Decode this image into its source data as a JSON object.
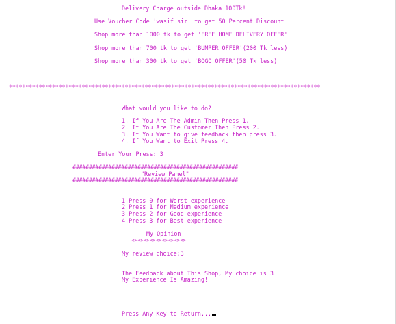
{
  "offers": {
    "line1": "Delivery Charge outside Dhaka 100Tk!",
    "line2": "Use Voucher Code 'wasif sir' to get 50 Percent Discount",
    "line3": "Shop more than 1000 tk to get 'FREE HOME DELIVERY OFFER'",
    "line4": "Shop more than 700 tk to get 'BUMPER OFFER'(200 Tk less)",
    "line5": "Shop more than 300 tk to get 'BOGO OFFER'(50 Tk less)"
  },
  "separator": "**********************************************************************************************",
  "main_menu": {
    "question": "What would you like to do?",
    "options": [
      "1. If You Are The Admin Then Press 1.",
      "2. If You Are The Customer Then Press 2.",
      "3. If You Want to give feedback then press 3.",
      "4. If You Want to Exit Press 4."
    ],
    "prompt": "Enter Your Press: 3"
  },
  "review_panel": {
    "border_top": "###################################################",
    "title": "\"Review Panel\"",
    "border_bottom": "###################################################",
    "options": [
      "1.Press 0 for Worst experience",
      "2.Press 1 for Medium experience",
      "3.Press 2 for Good experience",
      "4.Press 3 for Best experience"
    ],
    "opinion_heading": "My Opinion",
    "opinion_divider": "<><><><><><><><><>",
    "choice_line": "My review choice:3",
    "feedback_line1": "The Feedback about This Shop, My choice is 3",
    "feedback_line2": "My Experience Is Amazing!"
  },
  "footer": {
    "return_prompt": "Press Any Key to Return..."
  },
  "colors": {
    "text": "#c61fc6",
    "background": "#ffffff",
    "cursor": "#000000"
  }
}
